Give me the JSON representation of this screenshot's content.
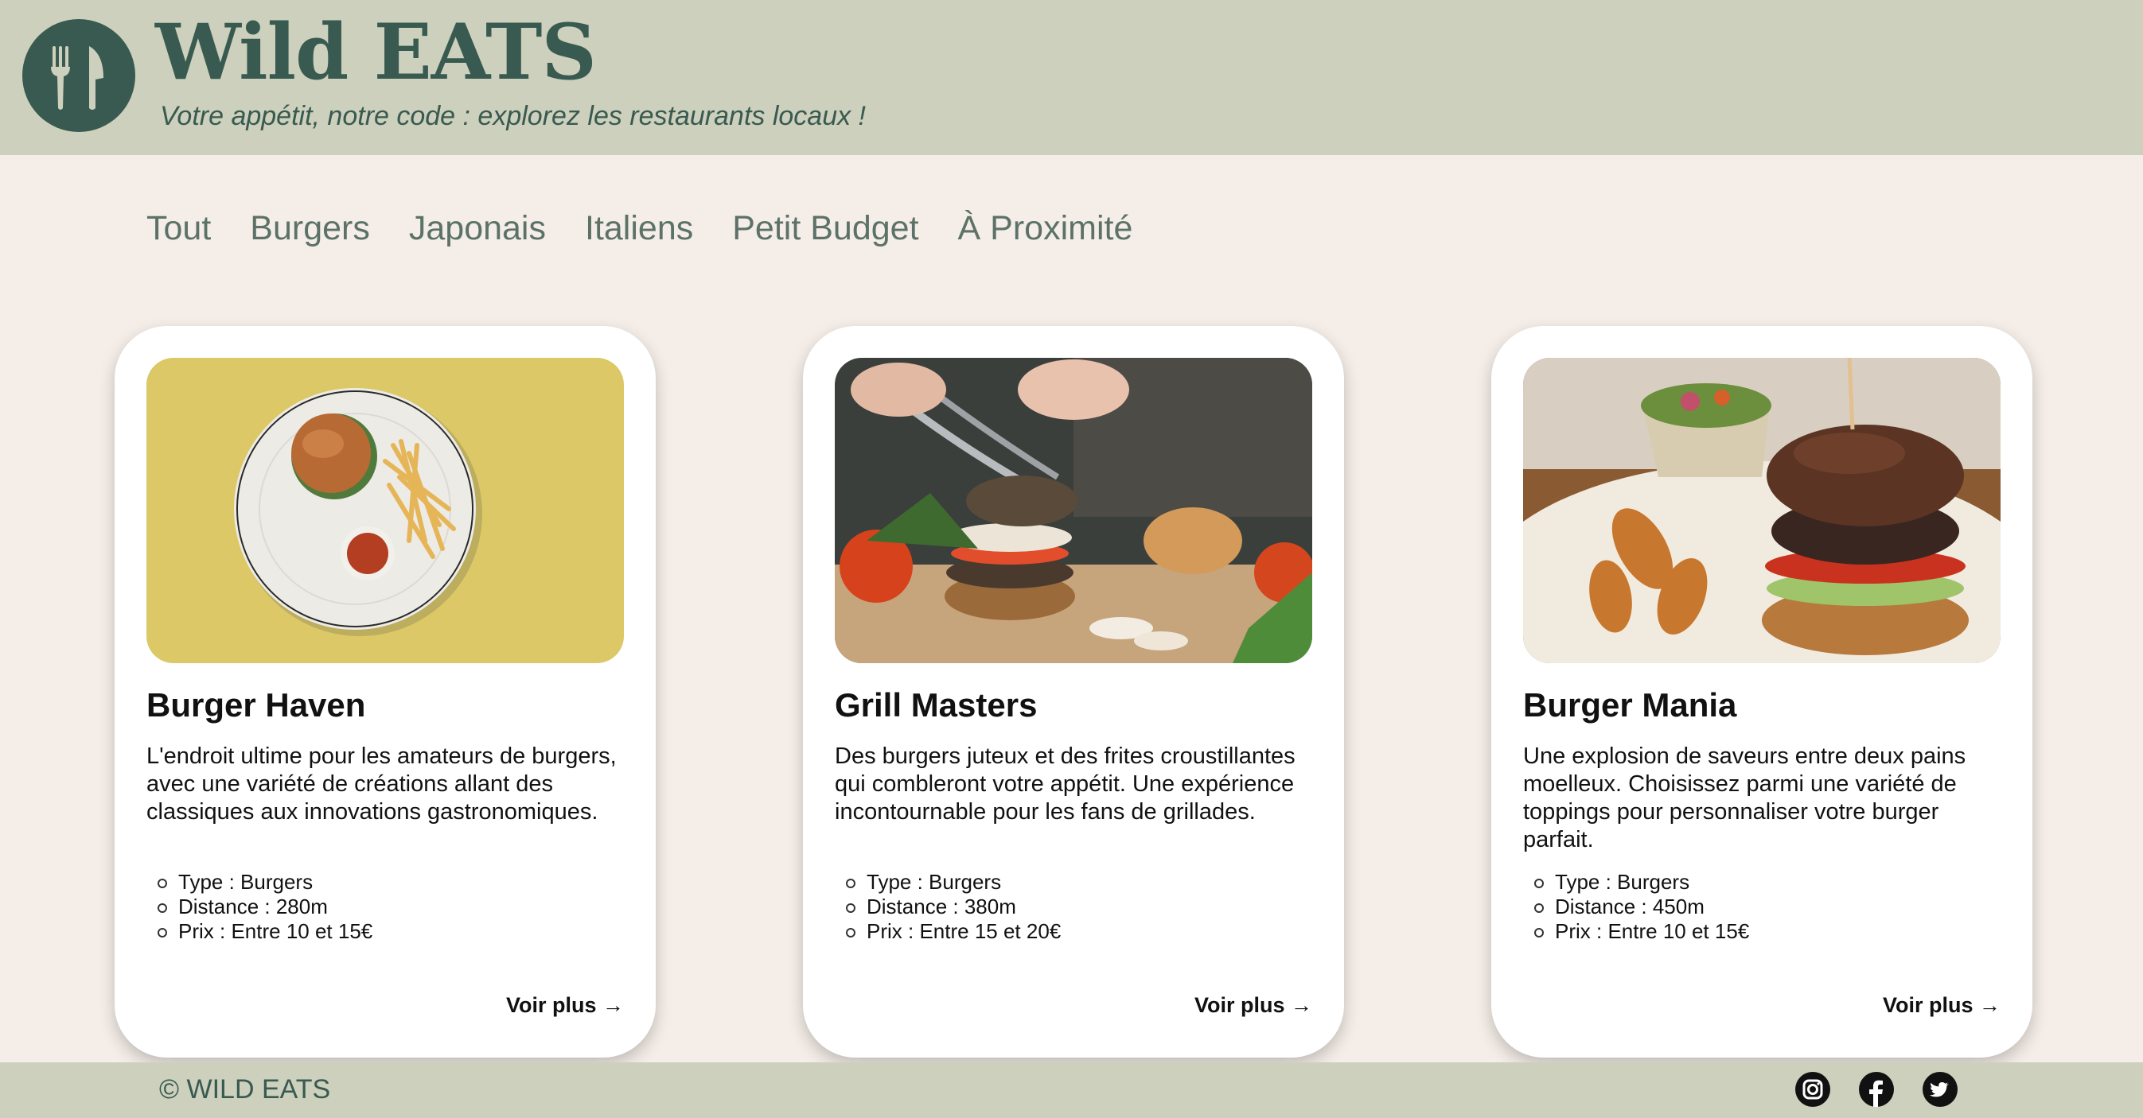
{
  "header": {
    "logo_icon": "fork-knife-icon",
    "brand": "Wild EATS",
    "tagline": "Votre appétit, notre code : explorez les restaurants locaux !"
  },
  "nav": {
    "items": [
      "Tout",
      "Burgers",
      "Japonais",
      "Italiens",
      "Petit Budget",
      "À Proximité"
    ]
  },
  "cards": [
    {
      "title": "Burger Haven",
      "description": "L'endroit ultime pour les amateurs de burgers, avec une variété de créations allant des classiques aux innovations gastronomiques.",
      "type": "Type : Burgers",
      "distance": "Distance : 280m",
      "price": "Prix : Entre 10 et 15€",
      "more": "Voir plus →"
    },
    {
      "title": "Grill Masters",
      "description": "Des burgers juteux et des frites croustillantes qui combleront votre appétit. Une expérience incontournable pour les fans de grillades.",
      "type": "Type : Burgers",
      "distance": "Distance : 380m",
      "price": "Prix : Entre 15 et 20€",
      "more": "Voir plus →"
    },
    {
      "title": "Burger Mania",
      "description": "Une explosion de saveurs entre deux pains moelleux. Choisissez parmi une variété de toppings pour personnaliser votre burger parfait.",
      "type": "Type : Burgers",
      "distance": "Distance : 450m",
      "price": "Prix : Entre 10 et 15€",
      "more": "Voir plus →"
    }
  ],
  "footer": {
    "copyright": "© WILD EATS",
    "social_icons": [
      "instagram-icon",
      "facebook-icon",
      "twitter-icon"
    ]
  },
  "colors": {
    "header_bg": "#ccd0bc",
    "page_bg": "#f5eee8",
    "brand_green": "#395a50",
    "nav_text": "#5c7268"
  }
}
